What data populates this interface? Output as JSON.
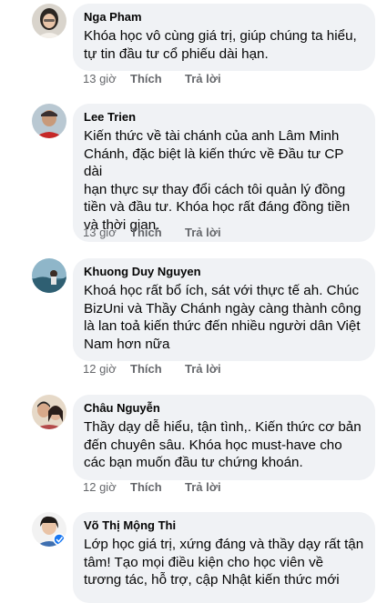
{
  "comments": [
    {
      "name": "Nga Pham",
      "text": "Khóa học vô cùng giá trị, giúp chúng ta hiểu,\ntự tin đầu tư cổ phiếu dài hạn.",
      "time": "13 giờ",
      "like": "Thích",
      "reply": "Trả lời"
    },
    {
      "name": "Lee Trien",
      "text": "Kiến thức về tài chánh của anh Lâm Minh\nChánh, đặc biệt là kiến thức về Đầu tư CP dài\nhạn thực sự thay đổi cách tôi quản lý đồng\ntiền và đầu tư. Khóa học rất đáng đồng tiền\nvà thời gian.",
      "time": "13 giờ",
      "like": "Thích",
      "reply": "Trả lời"
    },
    {
      "name": "Khuong Duy Nguyen",
      "text": "Khoá học rất bổ ích, sát với thực tế ah. Chúc\nBizUni và Thầy Chánh ngày càng thành công\nlà lan toả kiến thức đến nhiều người dân Việt\nNam hơn nữa",
      "time": "12 giờ",
      "like": "Thích",
      "reply": "Trả lời"
    },
    {
      "name": "Châu Nguyễn",
      "text": "Thầy dạy dễ hiểu, tận tình,. Kiến thức cơ bản\nđến chuyên sâu. Khóa học must-have cho\ncác bạn muốn đầu tư chứng khoán.",
      "time": "12 giờ",
      "like": "Thích",
      "reply": "Trả lời"
    },
    {
      "name": "Võ Thị Mộng Thi",
      "text": "Lớp học giá trị, xứng đáng và thầy dạy rất tận\ntâm! Tạo mọi điều kiện cho học viên về\ntương tác, hỗ trợ, cập Nhật kiến thức mới",
      "time": "",
      "like": "",
      "reply": ""
    }
  ]
}
